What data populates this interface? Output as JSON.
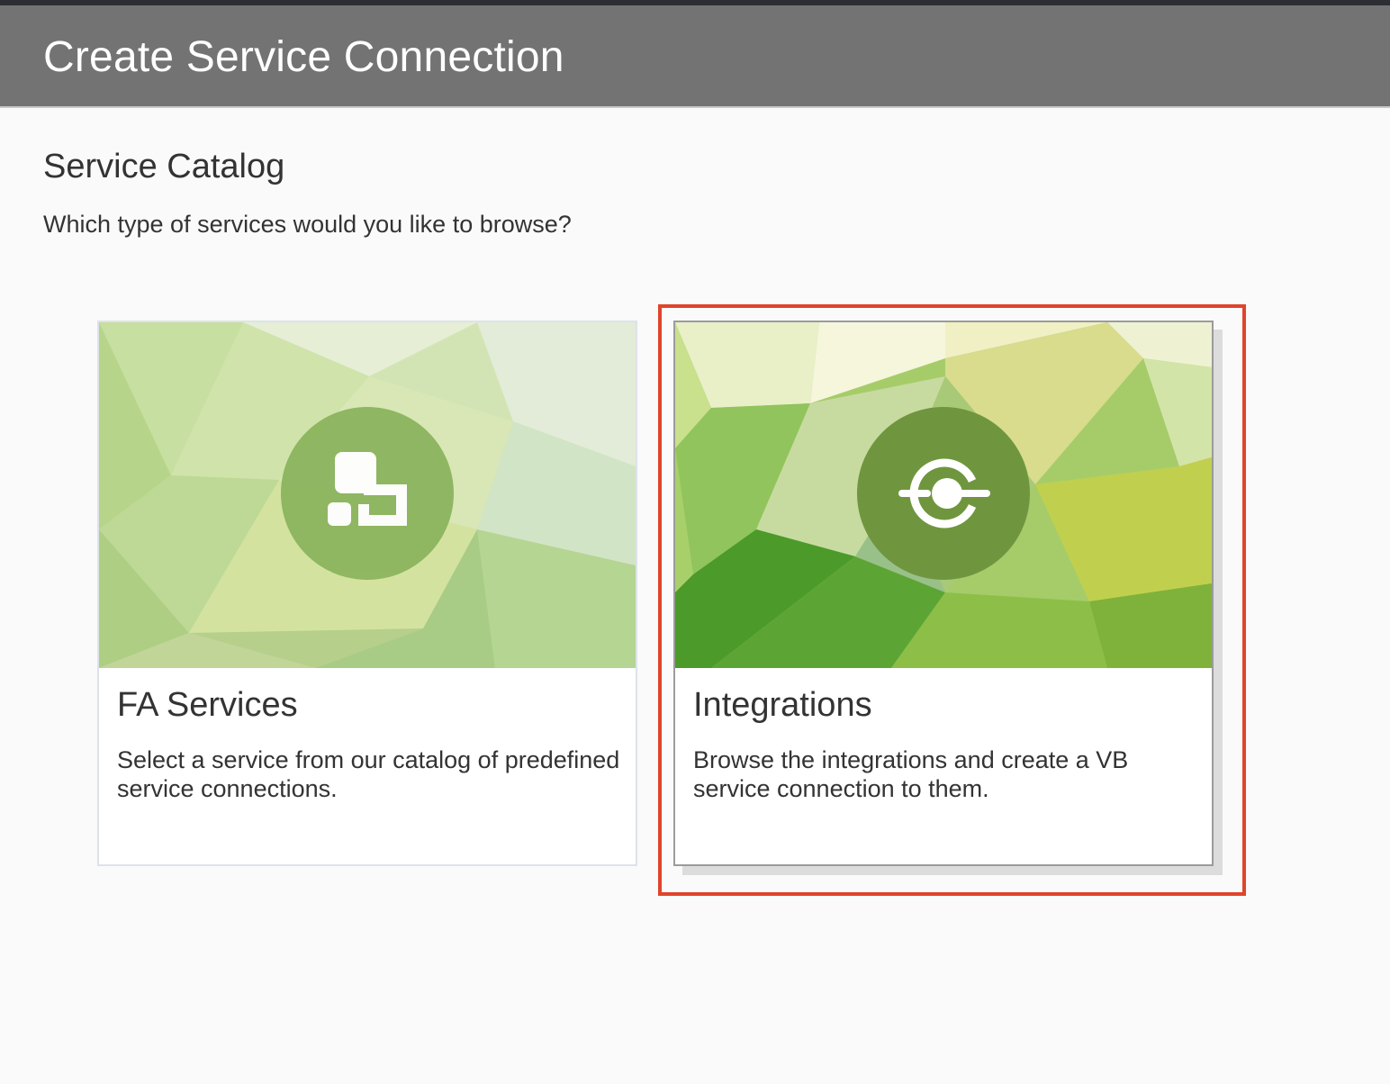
{
  "header": {
    "title": "Create Service Connection"
  },
  "catalog": {
    "title": "Service Catalog",
    "subtitle": "Which type of services would you like to browse?"
  },
  "cards": [
    {
      "title": "FA Services",
      "description": "Select a service from our catalog of predefined service connections.",
      "icon": "fa-services-blocks-icon"
    },
    {
      "title": "Integrations",
      "description": "Browse the integrations and create a VB service connection to them.",
      "icon": "integration-connector-icon",
      "highlighted": true
    }
  ],
  "colors": {
    "header_bg": "#737373",
    "highlight_border": "#e0442b",
    "card_accent_green": "#8cb45e"
  }
}
